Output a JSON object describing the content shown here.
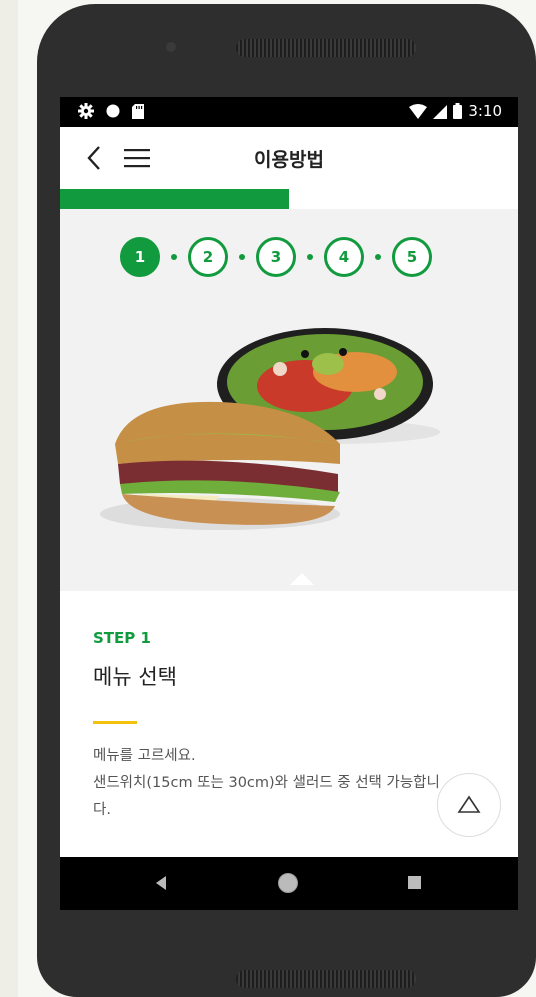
{
  "status_bar": {
    "time": "3:10"
  },
  "app_bar": {
    "title": "이용방법"
  },
  "progress": {
    "fraction": 0.5
  },
  "steps": [
    "1",
    "2",
    "3",
    "4",
    "5"
  ],
  "active_step": 1,
  "content": {
    "step_label": "STEP 1",
    "heading": "메뉴 선택",
    "description_line1": "메뉴를 고르세요.",
    "description_line2": "샌드위치(15cm 또는 30cm)와 샐러드 중 선택 가능합니",
    "description_line3": "다."
  },
  "colors": {
    "brand_green": "#129b3e",
    "accent_yellow": "#f4c20d"
  },
  "icons": [
    "settings-icon",
    "record-icon",
    "sd-card-icon",
    "wifi-icon",
    "signal-icon",
    "battery-icon",
    "back-arrow-icon",
    "hamburger-menu-icon",
    "scroll-top-icon"
  ]
}
